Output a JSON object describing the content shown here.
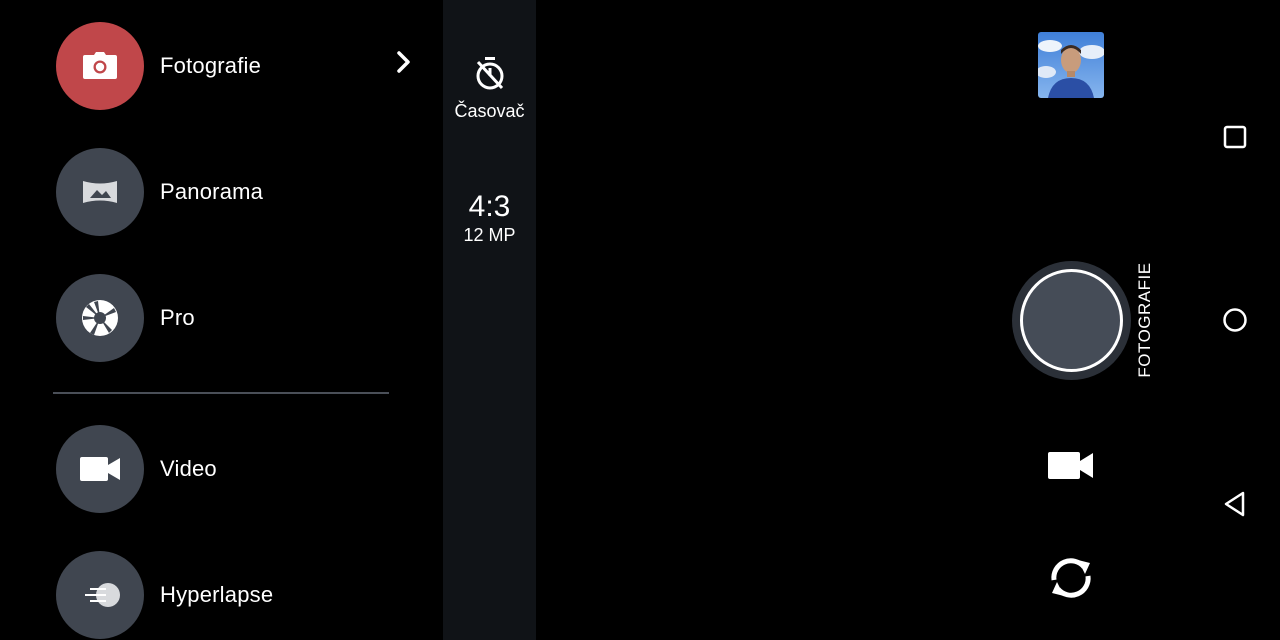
{
  "modes": [
    {
      "label": "Fotografie",
      "icon": "camera-icon",
      "active": true
    },
    {
      "label": "Panorama",
      "icon": "panorama-icon",
      "active": false
    },
    {
      "label": "Pro",
      "icon": "aperture-icon",
      "active": false
    },
    {
      "label": "Video",
      "icon": "video-camera-icon",
      "active": false
    },
    {
      "label": "Hyperlapse",
      "icon": "hyperlapse-icon",
      "active": false
    }
  ],
  "settings": {
    "timer_label": "Časovač",
    "aspect_ratio": "4:3",
    "resolution": "12 MP"
  },
  "current_mode": "FOTOGRAFIE",
  "colors": {
    "active_mode": "#c0474a",
    "inactive_mode": "#404650",
    "settings_bg": "#101317"
  },
  "nav": [
    "recents-icon",
    "home-icon",
    "back-icon"
  ]
}
